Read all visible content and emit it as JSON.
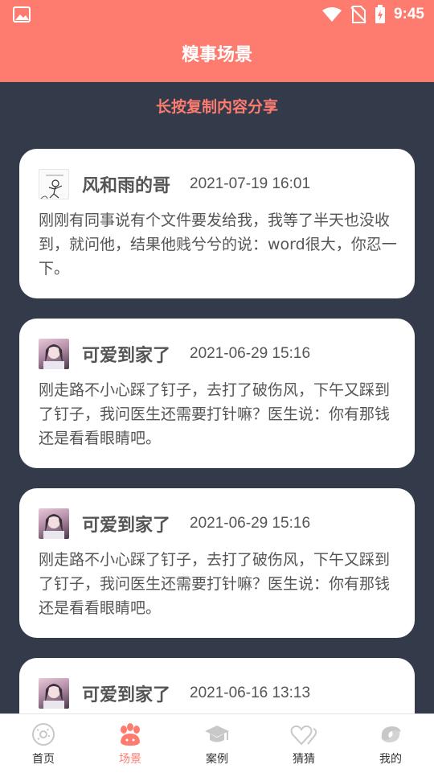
{
  "status_bar": {
    "time": "9:45"
  },
  "app_bar": {
    "title": "糗事场景"
  },
  "hint": "长按复制内容分享",
  "posts": [
    {
      "author": "风和雨的哥",
      "date": "2021-07-19 16:01",
      "content": "刚刚有同事说有个文件要发给我，我等了半天也没收到，就问他，结果他贱兮兮的说：word很大，你忍一下。",
      "avatar": "sketch-avatar"
    },
    {
      "author": "可爱到家了",
      "date": "2021-06-29 15:16",
      "content": "刚走路不小心踩了钉子，去打了破伤风，下午又踩到了钉子，我问医生还需要打针嘛？医生说：你有那钱还是看看眼睛吧。",
      "avatar": "girl-avatar"
    },
    {
      "author": "可爱到家了",
      "date": "2021-06-29 15:16",
      "content": "刚走路不小心踩了钉子，去打了破伤风，下午又踩到了钉子，我问医生还需要打针嘛？医生说：你有那钱还是看看眼睛吧。",
      "avatar": "girl-avatar"
    },
    {
      "author": "可爱到家了",
      "date": "2021-06-16 13:13",
      "content": "",
      "avatar": "girl-avatar"
    }
  ],
  "tabs": [
    {
      "label": "首页",
      "icon": "donut-icon",
      "active": false
    },
    {
      "label": "场景",
      "icon": "paw-icon",
      "active": true
    },
    {
      "label": "案例",
      "icon": "graduation-cap-icon",
      "active": false
    },
    {
      "label": "猜猜",
      "icon": "hearts-icon",
      "active": false
    },
    {
      "label": "我的",
      "icon": "swirl-icon",
      "active": false
    }
  ],
  "colors": {
    "accent": "#fd7b6f",
    "background": "#333a4a",
    "card": "#ffffff",
    "text": "#555555",
    "tab_inactive": "#cccccc"
  }
}
